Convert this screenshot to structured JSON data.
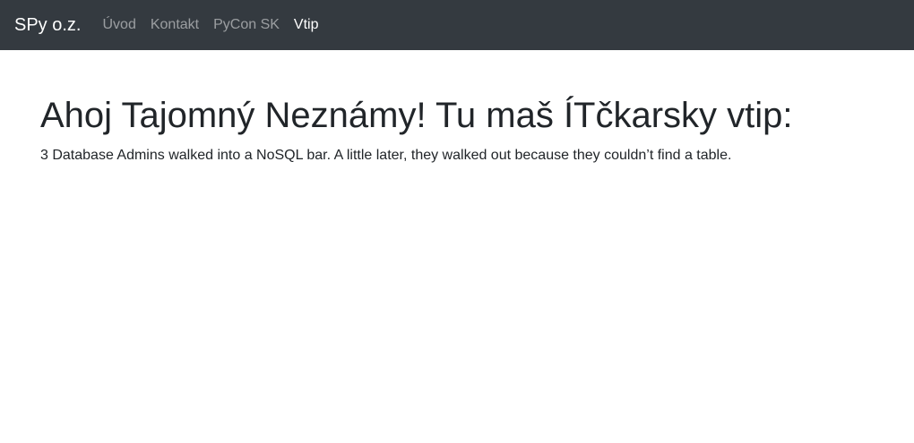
{
  "navbar": {
    "brand": "SPy o.z.",
    "items": [
      {
        "label": "Úvod",
        "active": false
      },
      {
        "label": "Kontakt",
        "active": false
      },
      {
        "label": "PyCon SK",
        "active": false
      },
      {
        "label": "Vtip",
        "active": true
      }
    ]
  },
  "main": {
    "heading": "Ahoj Tajomný Neznámy! Tu maš ÍTčkarsky vtip:",
    "joke": "3 Database Admins walked into a NoSQL bar. A little later, they walked out because they couldn’t find a table."
  },
  "colors": {
    "navbar_bg": "#343a40",
    "nav_inactive": "rgba(255,255,255,0.5)",
    "nav_active": "#ffffff",
    "text": "#212529"
  }
}
